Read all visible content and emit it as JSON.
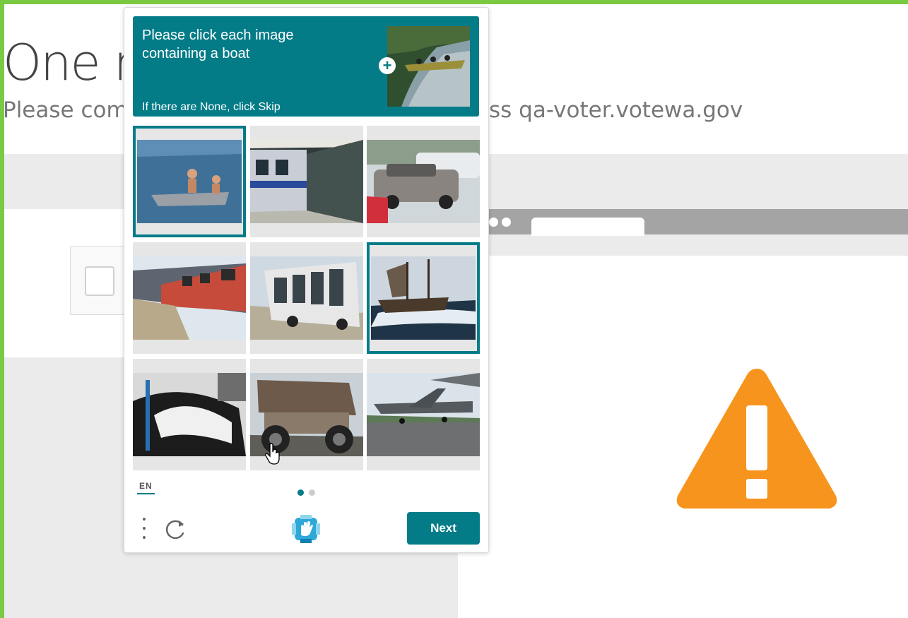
{
  "page": {
    "heading": "One r",
    "subtitle_left": "Please com",
    "subtitle_right": "ss qa-voter.votewa.gov"
  },
  "captcha": {
    "prompt": "Please click each image containing a boat",
    "skip_hint": "If there are None, click Skip",
    "tiles": [
      {
        "subject": "children-in-boat",
        "selected": true
      },
      {
        "subject": "train-in-station",
        "selected": false
      },
      {
        "subject": "parked-cars",
        "selected": false
      },
      {
        "subject": "train-at-platform",
        "selected": false
      },
      {
        "subject": "bus",
        "selected": false
      },
      {
        "subject": "sailing-ship",
        "selected": true
      },
      {
        "subject": "car-interior",
        "selected": false
      },
      {
        "subject": "dump-truck",
        "selected": false
      },
      {
        "subject": "airplane",
        "selected": false
      }
    ],
    "language": "EN",
    "pages_total": 2,
    "current_page": 1,
    "next_label": "Next"
  },
  "colors": {
    "accent": "#047c88",
    "warning": "#f7941d",
    "border_green": "#7ac943"
  }
}
